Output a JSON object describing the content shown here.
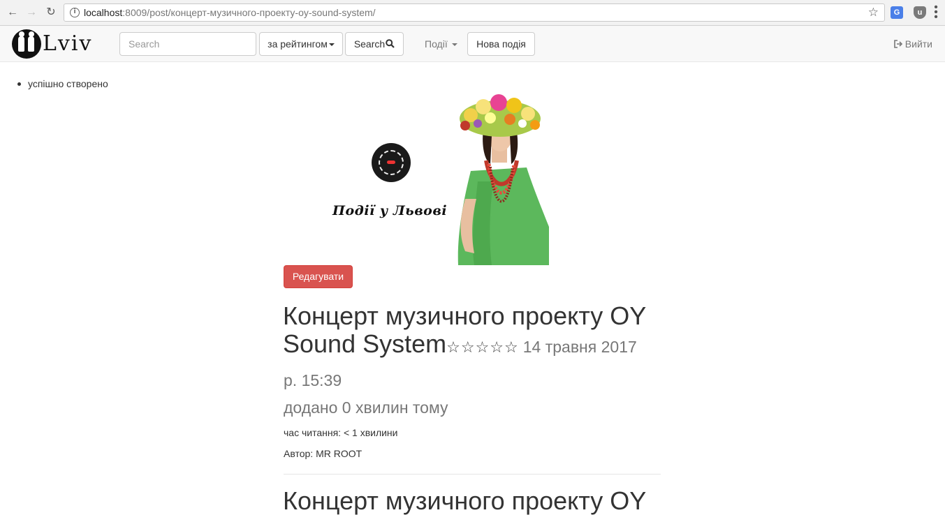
{
  "browser": {
    "url_host": "localhost",
    "url_rest": ":8009/post/концерт-музичного-проекту-oy-sound-system/"
  },
  "navbar": {
    "logo_text": "Lviv",
    "search_placeholder": "Search",
    "sort_button": "за рейтингом",
    "search_button": "Search",
    "events_dropdown": "Події",
    "new_event_button": "Нова подія",
    "logout": "Вийти"
  },
  "flash": {
    "message": "успішно створено"
  },
  "banner": {
    "caption": "Події у Львові"
  },
  "post": {
    "edit_button": "Редагувати",
    "title": "Концерт музичного проекту OY Sound System",
    "rating_stars": "☆☆☆☆☆",
    "date": "14 травня 2017",
    "time": "р. 15:39",
    "added": "додано 0 хвилин тому",
    "reading_time": "час читання: < 1 хвилини",
    "author": "Автор: MR ROOT",
    "body_title_start": "Концерт музичного проекту OY"
  },
  "colors": {
    "edit_button": "#d9534f",
    "navbar_bg": "#f8f8f8",
    "muted_text": "#777777"
  }
}
